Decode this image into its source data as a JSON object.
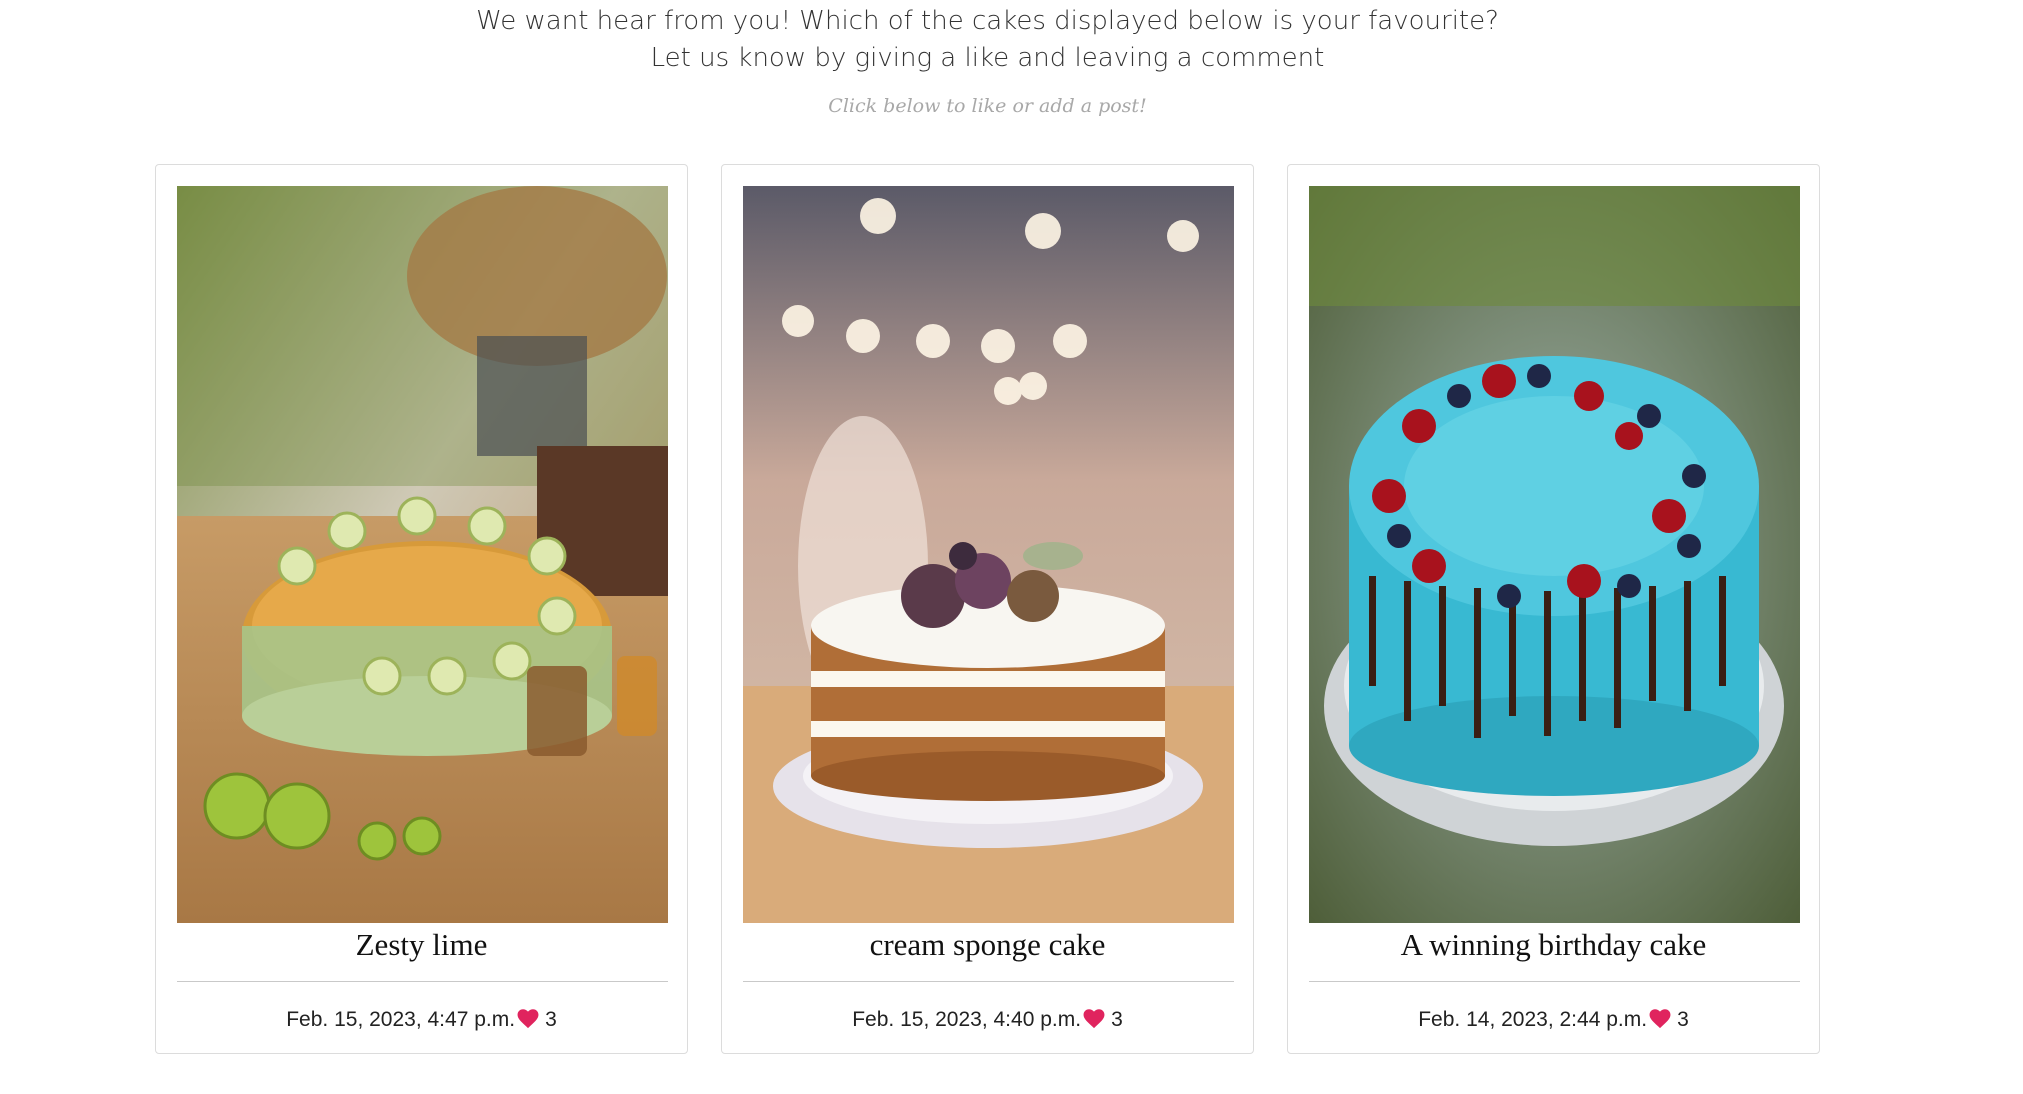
{
  "intro": {
    "line1": "We want hear from you! Which of the cakes displayed below is your favourite?",
    "line2": "Let us know by giving a like and leaving a comment",
    "hint": "Click below to like or add a post!"
  },
  "posts": [
    {
      "title": "Zesty lime",
      "date": "Feb. 15, 2023, 4:47 p.m.",
      "likes": "3",
      "image": "lime-layer-cake-photo"
    },
    {
      "title": "cream sponge cake",
      "date": "Feb. 15, 2023, 4:40 p.m.",
      "likes": "3",
      "image": "cream-sponge-cake-photo"
    },
    {
      "title": "A winning birthday cake",
      "date": "Feb. 14, 2023, 2:44 p.m.",
      "likes": "3",
      "image": "blue-birthday-cake-photo"
    }
  ],
  "colors": {
    "heart": "#e0245e",
    "hint": "#a8a8a8",
    "card_border": "#dcdcdc"
  },
  "icons": {
    "like": "heart-icon"
  }
}
